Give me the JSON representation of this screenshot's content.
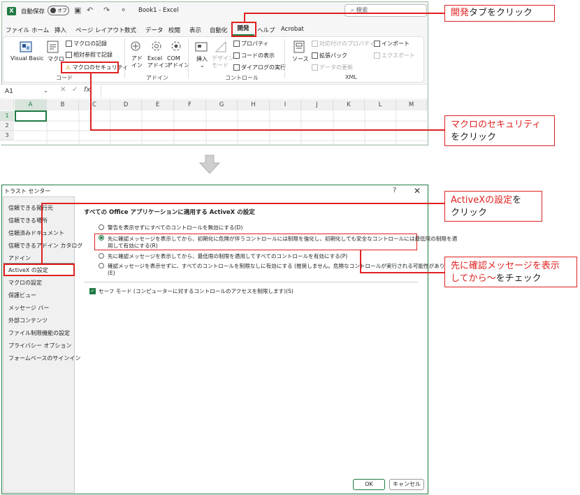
{
  "excel": {
    "logo": "X",
    "autosave_label": "自動保存",
    "autosave_state": "オフ",
    "book_title": "Book1  -  Excel",
    "search_placeholder": "検索",
    "menu": [
      "ファイル",
      "ホーム",
      "挿入",
      "ページ レイアウト",
      "数式",
      "データ",
      "校閲",
      "表示",
      "自動化",
      "開発",
      "ヘルプ",
      "Acrobat"
    ],
    "ribbon": {
      "visual_basic": "Visual Basic",
      "macro": "マクロ",
      "record_macro": "マクロの記録",
      "relative_ref": "相対参照で記録",
      "macro_security": "マクロのセキュリティ",
      "group_code": "コード",
      "addin_1": "アド\nイン",
      "addin_2": "Excel\nアドイン",
      "addin_3": "COM\nアドイン",
      "group_addin": "アドイン",
      "insert": "挿入",
      "design_mode": "デザイン\nモード",
      "properties": "プロパティ",
      "view_code": "コードの表示",
      "run_dialog": "ダイアログの実行",
      "group_controls": "コントロール",
      "source": "ソース",
      "map_properties": "対応付けのプロパティ",
      "expansion_packs": "拡張パック",
      "refresh_data": "データの更新",
      "import": "インポート",
      "export": "エクスポート",
      "group_xml": "XML"
    },
    "name_box": "A1",
    "fx": "fx",
    "columns": [
      "A",
      "B",
      "C",
      "D",
      "E",
      "F",
      "G",
      "H",
      "I",
      "J",
      "K",
      "L",
      "M"
    ],
    "rows": [
      "1",
      "2",
      "3"
    ]
  },
  "dialog": {
    "title": "トラスト センター",
    "help": "?",
    "close": "✕",
    "sidebar": [
      "信頼できる発行元",
      "信頼できる場所",
      "信頼済みドキュメント",
      "信頼できるアドイン カタログ",
      "アドイン",
      "ActiveX の設定",
      "マクロの設定",
      "保護ビュー",
      "メッセージ バー",
      "外部コンテンツ",
      "ファイル制限機能の設定",
      "プライバシー オプション",
      "フォームベースのサインイン"
    ],
    "section_title": "すべての Office アプリケーションに適用する ActiveX の設定",
    "options": [
      "警告を表示せずにすべてのコントロールを無効にする(D)",
      "先に確認メッセージを表示してから、初期化に危険が伴うコントロールには制限を強化し、初期化しても安全なコントロールには最低限の制限を適",
      "用して有効にする(R)",
      "先に確認メッセージを表示してから、最低限の制限を適用してすべてのコントロールを有効にする(P)",
      "確認メッセージを表示せずに、すべてのコントロールを制限なしに有効にする (推奨しません。危険なコントロールが実行される可能性があります)",
      "(E)"
    ],
    "safe_mode": "セーフ モード (コンピューターに対するコントロールのアクセスを制限します)(S)",
    "ok": "OK",
    "cancel": "キャンセル"
  },
  "callouts": {
    "c1_red": "開発",
    "c1_rest": "タブをクリック",
    "c2_red": "マクロのセキュリティ",
    "c2_rest": "をクリック",
    "c3_red": "ActiveXの設定",
    "c3_rest1": "を",
    "c3_rest2": "クリック",
    "c4_red": "先に確認メッセージを表示",
    "c4_red2": "してから〜",
    "c4_rest": "をチェック"
  },
  "colors": {
    "accent": "#1f7a43",
    "callout": "#e02020"
  }
}
